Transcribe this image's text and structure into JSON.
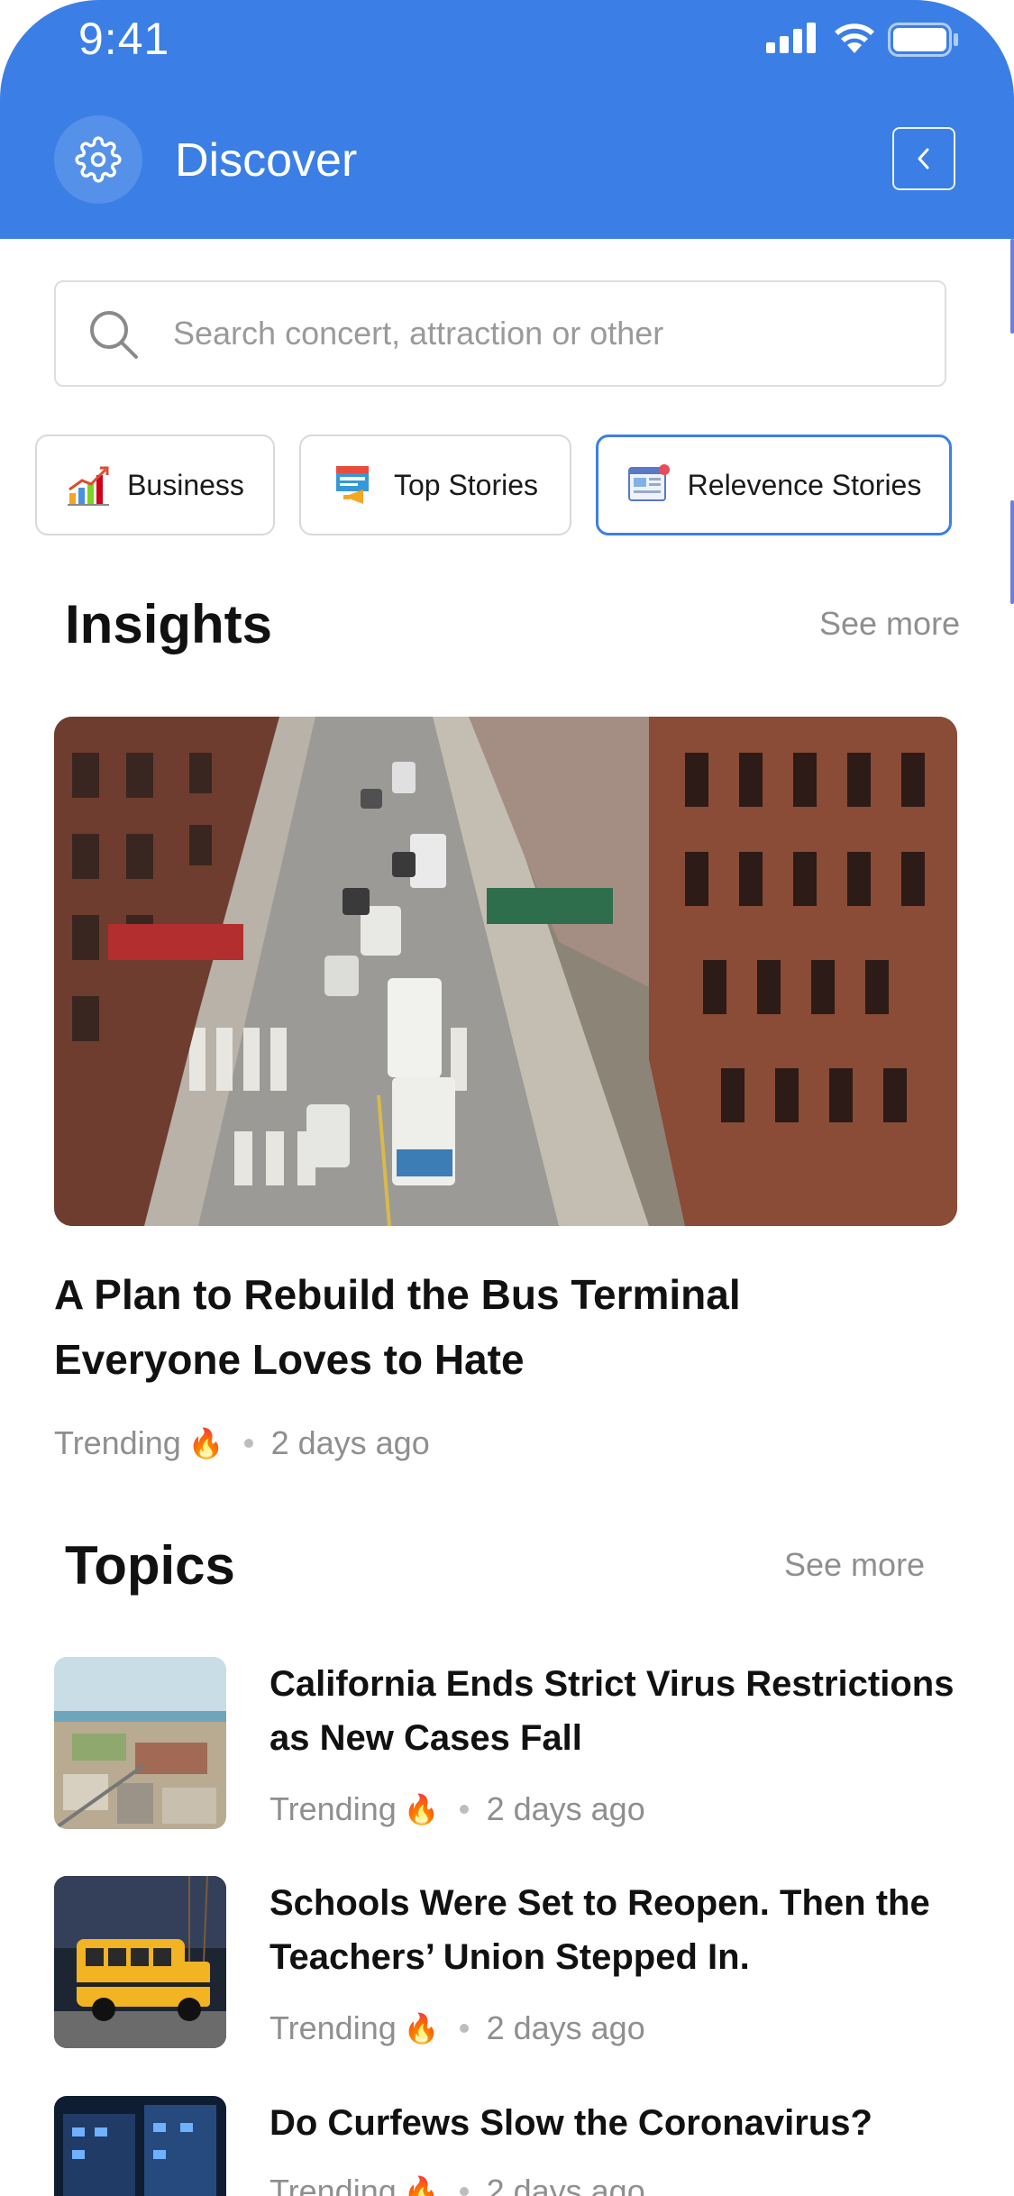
{
  "status_bar": {
    "time": "9:41"
  },
  "header": {
    "title": "Discover"
  },
  "search": {
    "placeholder": "Search concert, attraction or other"
  },
  "categories": [
    {
      "label": "Business",
      "icon": "bar-chart-icon"
    },
    {
      "label": "Top Stories",
      "icon": "news-megaphone-icon"
    },
    {
      "label": "Relevence Stories",
      "icon": "web-news-icon",
      "active": true
    }
  ],
  "insights": {
    "title": "Insights",
    "see_more": "See more",
    "featured": {
      "title": "A Plan to Rebuild the Bus Terminal Everyone Loves to Hate",
      "tag": "Trending",
      "time": "2 days ago"
    }
  },
  "topics": {
    "title": "Topics",
    "see_more": "See more",
    "items": [
      {
        "title": "California Ends Strict Virus Restrictions as New Cases Fall",
        "tag": "Trending",
        "time": "2 days ago"
      },
      {
        "title": "Schools Were Set to Reopen. Then the Teachers’ Union Stepped In.",
        "tag": "Trending",
        "time": "2 days ago"
      },
      {
        "title": "Do Curfews Slow the Coronavirus?",
        "tag": "Trending",
        "time": "2 days ago"
      }
    ]
  },
  "colors": {
    "primary": "#3b7fe6",
    "text": "#111111",
    "muted": "#8f8f8f"
  }
}
